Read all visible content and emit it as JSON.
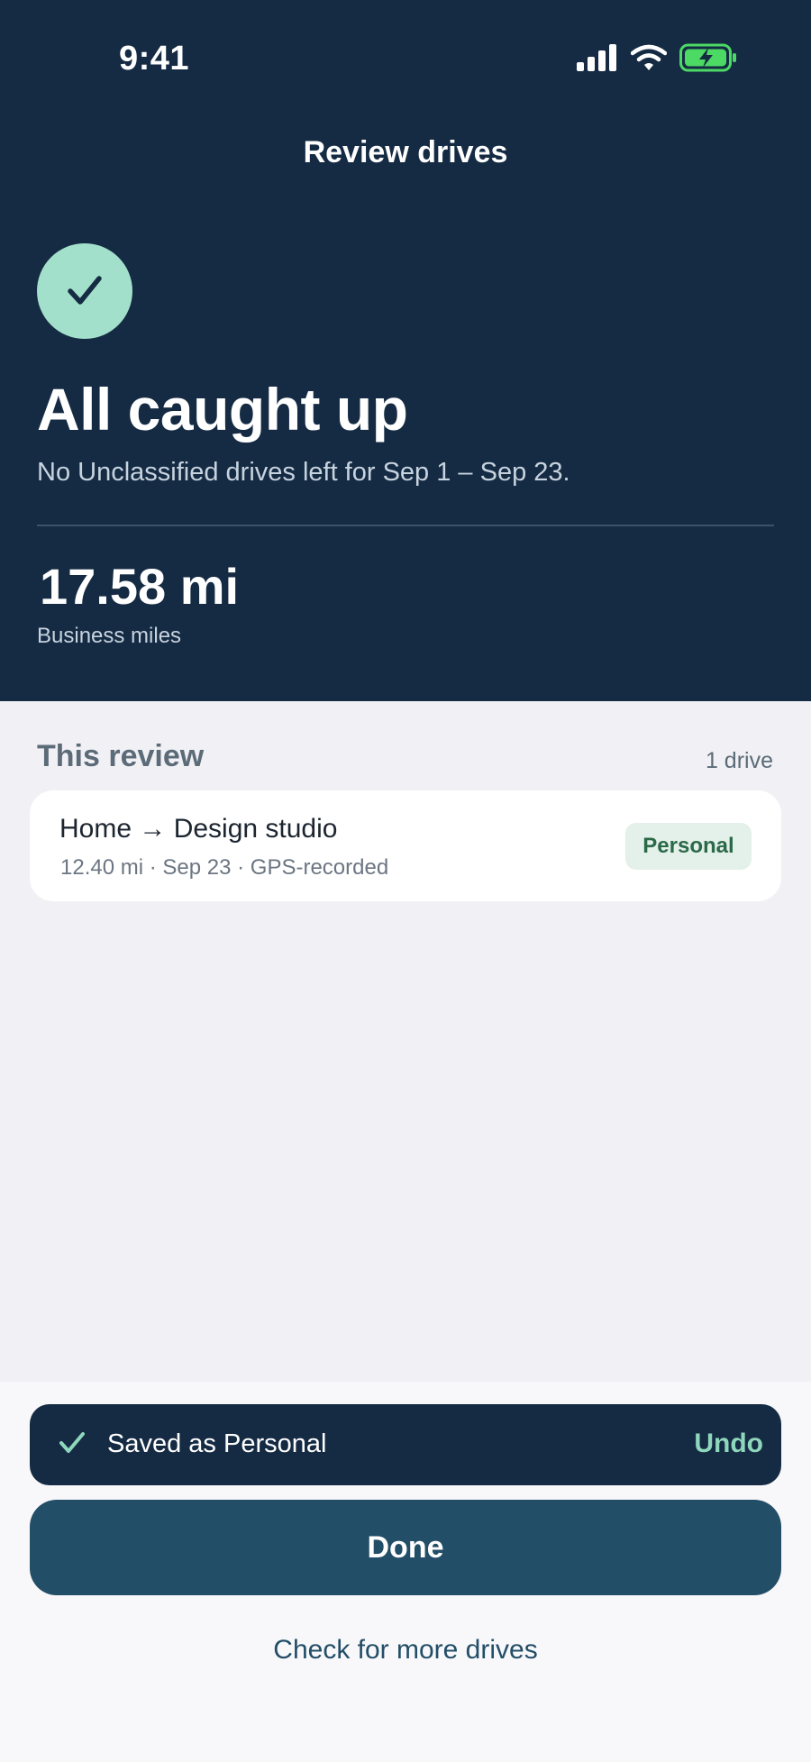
{
  "status_bar": {
    "time": "9:41",
    "icons": [
      "signal-icon",
      "wifi-icon",
      "battery-charging-icon"
    ]
  },
  "header": {
    "title": "Review drives",
    "icon": "check-icon",
    "headline": "All caught up",
    "subtext": "No Unclassified drives left for Sep 1 – Sep 23.",
    "miles_value": "17.58 mi",
    "miles_label": "Business miles"
  },
  "review": {
    "title": "This review",
    "count": "1 drive",
    "drives": [
      {
        "route": "Home → Design studio",
        "meta": "12.40 mi · Sep 23 · GPS-recorded",
        "classification": "Personal"
      }
    ]
  },
  "toast": {
    "icon": "check-icon",
    "message": "Saved as Personal",
    "action": "Undo"
  },
  "actions": {
    "done_label": "Done",
    "more_label": "Check for more drives"
  },
  "colors": {
    "header_bg": "#152B43",
    "accent_mint": "#A3E0CB",
    "primary_button": "#234E67",
    "badge_bg": "#E4F0EA",
    "badge_text": "#2B6A48",
    "battery_green": "#4CD964"
  }
}
